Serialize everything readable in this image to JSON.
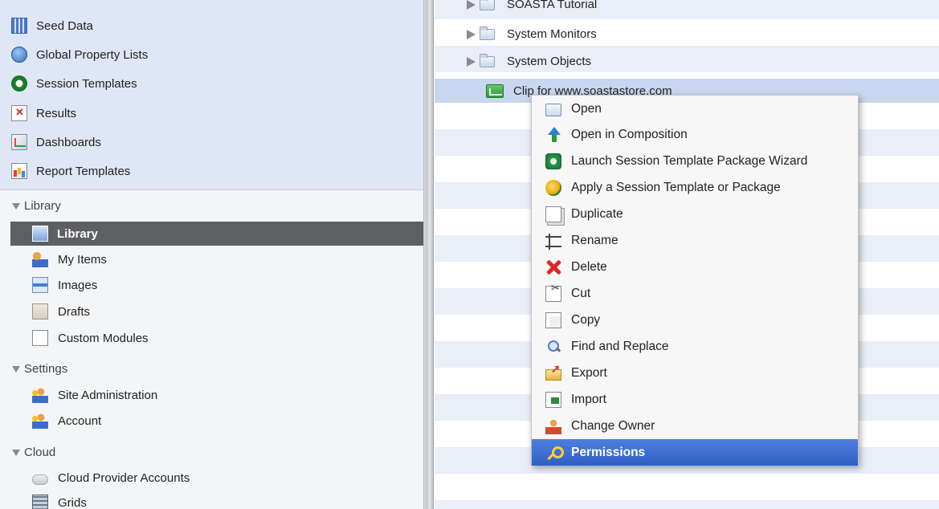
{
  "sidebar": {
    "top_items": [
      {
        "label": "Seed Data",
        "icon": "seed-data-icon"
      },
      {
        "label": "Global Property Lists",
        "icon": "globe-icon"
      },
      {
        "label": "Session Templates",
        "icon": "session-template-icon"
      },
      {
        "label": "Results",
        "icon": "results-icon"
      },
      {
        "label": "Dashboards",
        "icon": "dashboard-icon"
      },
      {
        "label": "Report Templates",
        "icon": "report-template-icon"
      }
    ],
    "sections": [
      {
        "label": "Library",
        "items": [
          {
            "label": "Library",
            "icon": "library-icon",
            "selected": true
          },
          {
            "label": "My Items",
            "icon": "my-items-icon"
          },
          {
            "label": "Images",
            "icon": "images-icon"
          },
          {
            "label": "Drafts",
            "icon": "drafts-icon"
          },
          {
            "label": "Custom Modules",
            "icon": "custom-modules-icon"
          }
        ]
      },
      {
        "label": "Settings",
        "items": [
          {
            "label": "Site Administration",
            "icon": "site-admin-icon"
          },
          {
            "label": "Account",
            "icon": "account-icon"
          }
        ]
      },
      {
        "label": "Cloud",
        "items": [
          {
            "label": "Cloud Provider Accounts",
            "icon": "cloud-icon"
          },
          {
            "label": "Grids",
            "icon": "grids-icon"
          }
        ]
      }
    ]
  },
  "tree": {
    "rows": [
      {
        "label": "SOASTA Tutorial",
        "type": "folder",
        "partial": true
      },
      {
        "label": "System Monitors",
        "type": "folder"
      },
      {
        "label": "System Objects",
        "type": "folder"
      },
      {
        "label": "Clip for www.soastastore.com",
        "type": "clip",
        "selected": true
      }
    ]
  },
  "context_menu": {
    "items": [
      {
        "label": "Open",
        "icon": "open-icon"
      },
      {
        "label": "Open in Composition",
        "icon": "open-composition-icon"
      },
      {
        "label": "Launch Session Template Package Wizard",
        "icon": "launch-wizard-icon"
      },
      {
        "label": "Apply a Session Template or Package",
        "icon": "apply-template-icon"
      },
      {
        "label": "Duplicate",
        "icon": "duplicate-icon"
      },
      {
        "label": "Rename",
        "icon": "rename-icon"
      },
      {
        "label": "Delete",
        "icon": "delete-icon"
      },
      {
        "label": "Cut",
        "icon": "cut-icon"
      },
      {
        "label": "Copy",
        "icon": "copy-icon"
      },
      {
        "label": "Find and Replace",
        "icon": "find-replace-icon"
      },
      {
        "label": "Export",
        "icon": "export-icon"
      },
      {
        "label": "Import",
        "icon": "import-icon"
      },
      {
        "label": "Change Owner",
        "icon": "change-owner-icon"
      },
      {
        "label": "Permissions",
        "icon": "permissions-icon",
        "highlighted": true
      }
    ]
  },
  "colors": {
    "sidebar_top_bg": "#dfe6f6",
    "sidebar_selected_bg": "#5e5f62",
    "stripe_row": "#e9eef9",
    "tree_selected_row": "#c8d6ef",
    "menu_highlight": "#3666cc"
  }
}
